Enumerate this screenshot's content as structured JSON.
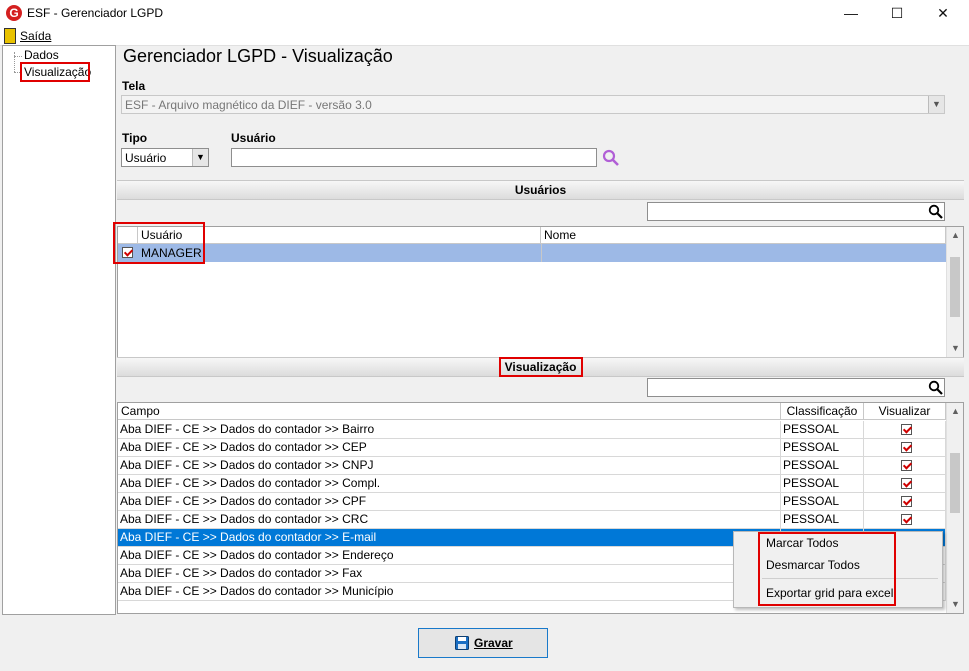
{
  "window": {
    "title": "ESF - Gerenciador LGPD",
    "app_icon": "G",
    "minimize": "—",
    "maximize": "☐",
    "close": "✕"
  },
  "menu": {
    "exit_label": "Saída"
  },
  "tree": {
    "items": [
      {
        "label": "Dados"
      },
      {
        "label": "Visualização"
      }
    ]
  },
  "page_title": "Gerenciador LGPD - Visualização",
  "tela": {
    "label": "Tela",
    "value": "ESF - Arquivo magnético da DIEF - versão 3.0"
  },
  "tipo": {
    "label": "Tipo",
    "value": "Usuário"
  },
  "usuario": {
    "label": "Usuário",
    "value": ""
  },
  "users_section": {
    "title": "Usuários",
    "search": "",
    "columns": [
      "Usuário",
      "Nome"
    ],
    "rows": [
      {
        "usuario": "MANAGER",
        "nome": "",
        "checked": true
      }
    ]
  },
  "view_section": {
    "title": "Visualização",
    "search": "",
    "columns": [
      "Campo",
      "Classificação",
      "Visualizar"
    ],
    "rows": [
      {
        "campo": "Aba DIEF - CE >> Dados do contador >> Bairro",
        "classificacao": "PESSOAL",
        "visualizar": true
      },
      {
        "campo": "Aba DIEF - CE >> Dados do contador >> CEP",
        "classificacao": "PESSOAL",
        "visualizar": true
      },
      {
        "campo": "Aba DIEF - CE >> Dados do contador >> CNPJ",
        "classificacao": "PESSOAL",
        "visualizar": true
      },
      {
        "campo": "Aba DIEF - CE >> Dados do contador >> Compl.",
        "classificacao": "PESSOAL",
        "visualizar": true
      },
      {
        "campo": "Aba DIEF - CE >> Dados do contador >> CPF",
        "classificacao": "PESSOAL",
        "visualizar": true
      },
      {
        "campo": "Aba DIEF - CE >> Dados do contador >> CRC",
        "classificacao": "PESSOAL",
        "visualizar": true
      },
      {
        "campo": "Aba DIEF - CE >> Dados do contador >> E-mail",
        "classificacao": "",
        "visualizar": false
      },
      {
        "campo": "Aba DIEF - CE >> Dados do contador >> Endereço",
        "classificacao": "",
        "visualizar": false
      },
      {
        "campo": "Aba DIEF - CE >> Dados do contador >> Fax",
        "classificacao": "",
        "visualizar": false
      },
      {
        "campo": "Aba DIEF - CE >> Dados do contador >> Município",
        "classificacao": "",
        "visualizar": false
      }
    ]
  },
  "context_menu": {
    "items": [
      "Marcar Todos",
      "Desmarcar Todos",
      "Exportar grid para excel"
    ]
  },
  "save_button": {
    "label": "Gravar"
  },
  "colors": {
    "highlight_red": "#e00000",
    "selected_row": "#0078d7",
    "user_row": "#9db9e6"
  }
}
